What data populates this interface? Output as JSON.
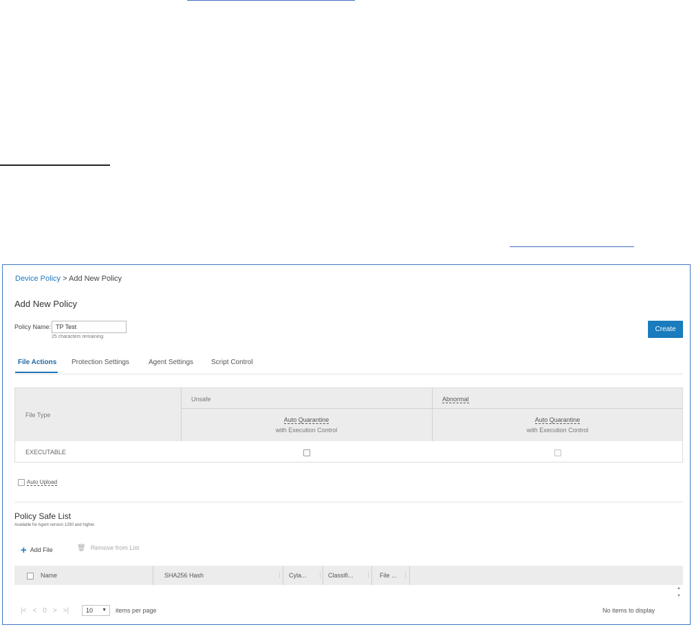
{
  "breadcrumb": {
    "link": "Device Policy",
    "separator": ">",
    "current": "Add New Policy"
  },
  "page_title": "Add New Policy",
  "policy_name": {
    "label": "Policy Name:",
    "value": "TP Test",
    "hint": "25 characters remaining"
  },
  "create_label": "Create",
  "tabs": [
    {
      "label": "File Actions",
      "active": true
    },
    {
      "label": "Protection Settings"
    },
    {
      "label": "Agent Settings"
    },
    {
      "label": "Script Control"
    }
  ],
  "file_actions": {
    "file_type_header": "File Type",
    "unsafe_header": "Unsafe",
    "abnormal_header": "Abnormal",
    "action_title": "Auto Quarantine",
    "action_sub": "with Execution Control",
    "rows": [
      {
        "type": "EXECUTABLE",
        "unsafe_checked": false,
        "abnormal_checked": false
      }
    ]
  },
  "auto_upload": {
    "label": "Auto Upload",
    "checked": false
  },
  "safe_list": {
    "title": "Policy Safe List",
    "subtitle": "Available for Agent version 1290 and higher.",
    "add_label": "Add File",
    "remove_label": "Remove from List",
    "columns": [
      "Name",
      "SHA256 Hash",
      "Cyla...",
      "Classifi...",
      "File ..."
    ]
  },
  "pager": {
    "first": "|<",
    "prev": "<",
    "page": "0",
    "next": ">",
    "last": ">|",
    "page_size": "10",
    "per_page_label": "items per page",
    "empty_text": "No items to display"
  },
  "icons": {
    "add": "plus-icon",
    "remove": "trash-icon",
    "menu": "column-menu-icon",
    "caret": "caret-down-icon"
  },
  "colors": {
    "accent": "#1a7bbd",
    "frame": "#3f76c2",
    "header_bg": "#ececec"
  }
}
